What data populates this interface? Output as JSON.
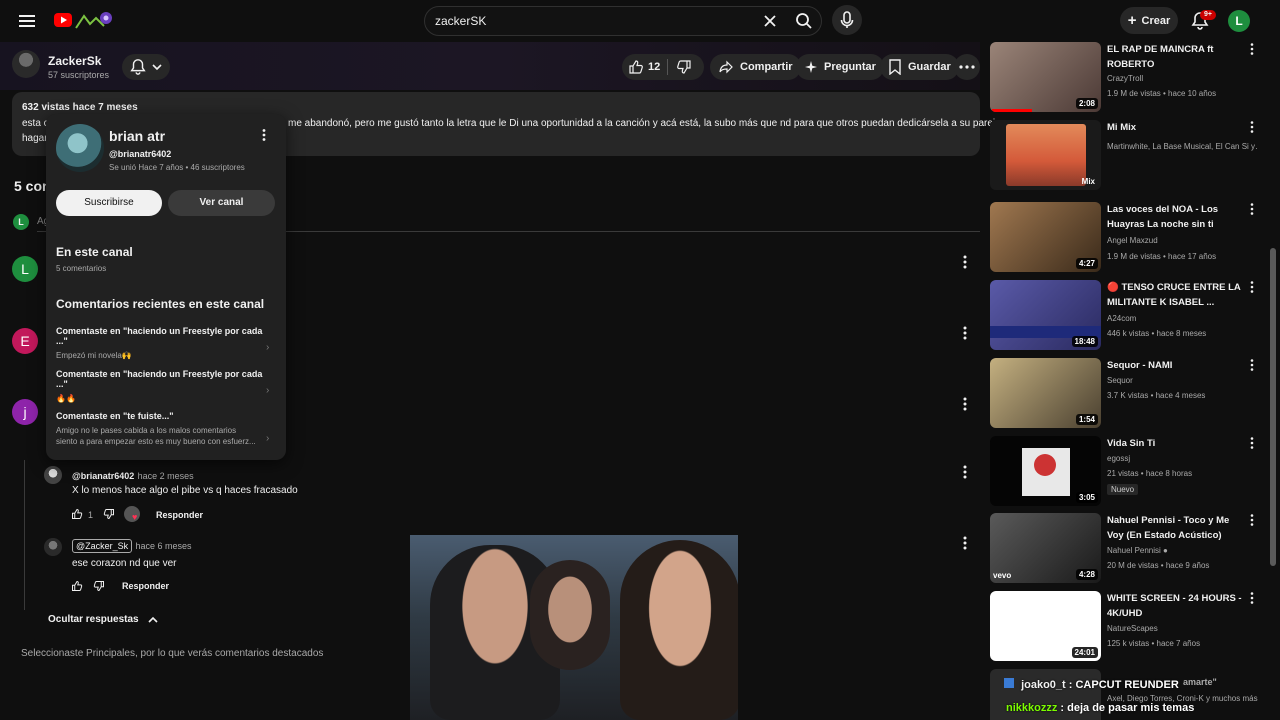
{
  "header": {
    "search_value": "zackerSK",
    "create_label": "Crear",
    "notif_count": "9+",
    "user_initial": "L"
  },
  "channel": {
    "name": "ZackerSk",
    "subs": "57 suscriptores"
  },
  "actions": {
    "likes": "12",
    "share": "Compartir",
    "ask": "Preguntar",
    "save": "Guardar"
  },
  "description": {
    "meta": "632 vistas  hace 7 meses",
    "line1_start": "esta c",
    "line2_start": "hagar",
    "line1_rest": "me abandonó, pero me gustó tanto la letra que le Di una oportunidad a la canción y acá está, la subo más que nd para que otros puedan dedicársela a su pareja,"
  },
  "comments": {
    "count_label": "5 com",
    "add_placeholder": "Ag",
    "add_initial": "L",
    "avatars": [
      {
        "initial": "L",
        "color": "#1e8e3e"
      },
      {
        "initial": "E",
        "color": "#c2185b"
      },
      {
        "initial": "j",
        "color": "#8e24aa"
      }
    ],
    "replies": [
      {
        "handle": "@brianatr6402",
        "time": "hace 2 meses",
        "text": "X lo menos hace algo el pibe vs q haces fracasado",
        "likes": "1",
        "reply_label": "Responder"
      },
      {
        "handle": "@Zacker_Sk",
        "time": "hace 6 meses",
        "text": "ese corazon nd que ver",
        "likes": "",
        "reply_label": "Responder"
      }
    ],
    "hide_replies": "Ocultar respuestas",
    "footer_note": "Seleccionaste Principales, por lo que verás comentarios destacados"
  },
  "popup": {
    "name": "brian atr",
    "handle": "@brianatr6402",
    "meta": "Se unió Hace 7 años • 46 suscriptores",
    "subscribe": "Suscribirse",
    "view_channel": "Ver canal",
    "section1_title": "En este canal",
    "section1_count": "5 comentarios",
    "section2_title": "Comentarios recientes en este canal",
    "recent": [
      {
        "title": "Comentaste en \"haciendo un Freestyle por cada ...\"",
        "text": "Empezó mi novela🙌"
      },
      {
        "title": "Comentaste en \"haciendo un Freestyle por cada ...\"",
        "text": "🔥🔥"
      },
      {
        "title": "Comentaste en \"te fuiste...\"",
        "text": "Amigo no le pases cabida a los malos comentarios",
        "text2": "siento a para empezar esto es muy bueno con esfuerz..."
      }
    ]
  },
  "sidebar": [
    {
      "title": "EL RAP DE MAINCRA ft ROBERTO",
      "channel": "CrazyTroll",
      "meta": "1.9 M de vistas • hace 10 años",
      "duration": "2:08",
      "thumb": "#6b5a55"
    },
    {
      "title": "Mi Mix",
      "channel": "Martinwhite, La Base Musical, El Can Si y…",
      "meta": "",
      "duration": "Mix",
      "thumb": "#c0603a"
    },
    {
      "title": "Las voces del NOA - Los Huayras   La noche sin ti",
      "channel": "Angel Maxzud",
      "meta": "1.9 M de vistas • hace 17 años",
      "duration": "4:27",
      "thumb": "#7a5a3a"
    },
    {
      "title": "🔴 TENSO CRUCE ENTRE LA MILITANTE K ISABEL ...",
      "channel": "A24com",
      "meta": "446 k vistas • hace 8 meses",
      "duration": "18:48",
      "thumb": "#4a4a88"
    },
    {
      "title": "Sequor - NAMI",
      "channel": "Sequor",
      "meta": "3.7 K vistas • hace 4 meses",
      "duration": "1:54",
      "thumb": "#8a7a50"
    },
    {
      "title": "Vida Sin Ti",
      "channel": "egossj",
      "meta": "21 vistas • hace 8 horas",
      "duration": "3:05",
      "badge": "Nuevo",
      "thumb": "#101010"
    },
    {
      "title": "Nahuel Pennisi - Toco y Me Voy (En Estado Acústico)",
      "channel": "Nahuel Pennisi",
      "meta": "20 M de vistas • hace 9 años",
      "duration": "4:28",
      "thumb": "#3a3a3a"
    },
    {
      "title": "WHITE SCREEN - 24 HOURS - 4K/UHD",
      "channel": "NatureScapes",
      "meta": "125 k vistas • hace 7 años",
      "duration": "24:01",
      "thumb": "#ffffff"
    },
    {
      "title": "amarte\"",
      "channel": "Axel, Diego Torres, Croni-K y muchos más",
      "meta": "",
      "duration": "",
      "thumb": "#2a2a2a"
    }
  ],
  "chat": [
    {
      "user": "joako0_t",
      "message": ": CAPCUT REUNDER"
    },
    {
      "user": "nikkkozzz",
      "message": ": deja de pasar mis temas"
    }
  ],
  "colors": {
    "accent_red": "#ff0000",
    "background": "#0f0f0f",
    "chip": "#272727",
    "chat_user_green": "#7cfc00"
  }
}
